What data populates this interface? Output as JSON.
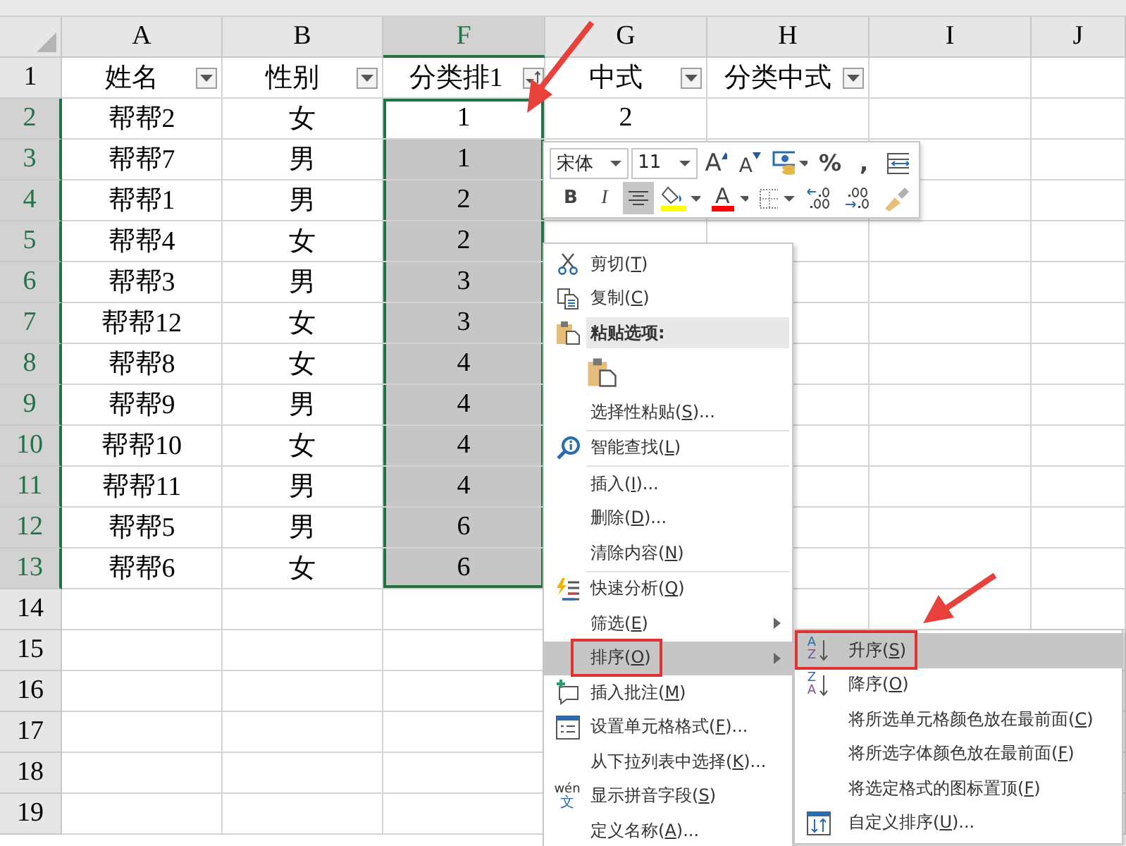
{
  "columns": [
    {
      "label": "A",
      "selected": false
    },
    {
      "label": "B",
      "selected": false
    },
    {
      "label": "F",
      "selected": true
    },
    {
      "label": "G",
      "selected": false
    },
    {
      "label": "H",
      "selected": false
    },
    {
      "label": "I",
      "selected": false
    },
    {
      "label": "J",
      "selected": false
    }
  ],
  "rows": [
    {
      "number": "1",
      "selected": false,
      "active": false,
      "cells": [
        {
          "text": "姓名",
          "kind": "dropdown"
        },
        {
          "text": "性别",
          "kind": "dropdown"
        },
        {
          "text": "分类排1",
          "kind": "sort"
        },
        {
          "text": "中式",
          "kind": "dropdown"
        },
        {
          "text": "分类中式",
          "kind": "dropdown"
        }
      ]
    },
    {
      "number": "2",
      "selected": true,
      "active": true,
      "cells": [
        {
          "text": "帮帮2"
        },
        {
          "text": "女"
        },
        {
          "text": "1"
        },
        {
          "text": "2"
        }
      ]
    },
    {
      "number": "3",
      "selected": true,
      "active": false,
      "cells": [
        {
          "text": "帮帮7"
        },
        {
          "text": "男"
        },
        {
          "text": "1"
        }
      ]
    },
    {
      "number": "4",
      "selected": true,
      "active": false,
      "cells": [
        {
          "text": "帮帮1"
        },
        {
          "text": "男"
        },
        {
          "text": "2"
        }
      ]
    },
    {
      "number": "5",
      "selected": true,
      "active": false,
      "cells": [
        {
          "text": "帮帮4"
        },
        {
          "text": "女"
        },
        {
          "text": "2"
        }
      ]
    },
    {
      "number": "6",
      "selected": true,
      "active": false,
      "cells": [
        {
          "text": "帮帮3"
        },
        {
          "text": "男"
        },
        {
          "text": "3"
        }
      ]
    },
    {
      "number": "7",
      "selected": true,
      "active": false,
      "cells": [
        {
          "text": "帮帮12"
        },
        {
          "text": "女"
        },
        {
          "text": "3"
        }
      ]
    },
    {
      "number": "8",
      "selected": true,
      "active": false,
      "cells": [
        {
          "text": "帮帮8"
        },
        {
          "text": "女"
        },
        {
          "text": "4"
        }
      ]
    },
    {
      "number": "9",
      "selected": true,
      "active": false,
      "cells": [
        {
          "text": "帮帮9"
        },
        {
          "text": "男"
        },
        {
          "text": "4"
        }
      ]
    },
    {
      "number": "10",
      "selected": true,
      "active": false,
      "cells": [
        {
          "text": "帮帮10"
        },
        {
          "text": "女"
        },
        {
          "text": "4"
        }
      ]
    },
    {
      "number": "11",
      "selected": true,
      "active": false,
      "cells": [
        {
          "text": "帮帮11"
        },
        {
          "text": "男"
        },
        {
          "text": "4"
        }
      ]
    },
    {
      "number": "12",
      "selected": true,
      "active": false,
      "cells": [
        {
          "text": "帮帮5"
        },
        {
          "text": "男"
        },
        {
          "text": "6"
        }
      ]
    },
    {
      "number": "13",
      "selected": true,
      "active": false,
      "cells": [
        {
          "text": "帮帮6"
        },
        {
          "text": "女"
        },
        {
          "text": "6"
        }
      ]
    },
    {
      "number": "14",
      "selected": false,
      "active": false
    },
    {
      "number": "15",
      "selected": false,
      "active": false
    },
    {
      "number": "16",
      "selected": false,
      "active": false
    },
    {
      "number": "17",
      "selected": false,
      "active": false
    },
    {
      "number": "18",
      "selected": false,
      "active": false
    },
    {
      "number": "19",
      "selected": false,
      "active": false
    }
  ],
  "mini_toolbar": {
    "font": "宋体",
    "size": "11",
    "row_1": [
      {
        "kind": "grow-font",
        "label": "A",
        "selected": false
      },
      {
        "kind": "shrink-font",
        "label": "A",
        "selected": false
      },
      {
        "kind": "number-format",
        "selected": false
      },
      {
        "kind": "percent",
        "label": "%",
        "selected": false
      },
      {
        "kind": "comma",
        "label": ",",
        "selected": false
      },
      {
        "kind": "merge",
        "selected": false
      }
    ],
    "row_2": [
      {
        "kind": "bold",
        "label": "B",
        "selected": false
      },
      {
        "kind": "italic",
        "label": "I",
        "selected": false
      },
      {
        "kind": "center",
        "selected": true
      },
      {
        "kind": "fill-color",
        "color": "#ffff00",
        "selected": false
      },
      {
        "kind": "font-color",
        "label": "A",
        "color": "#ff0000",
        "selected": false
      },
      {
        "kind": "borders",
        "selected": false
      },
      {
        "kind": "increase-decimal",
        "selected": false
      },
      {
        "kind": "decrease-decimal",
        "selected": false
      },
      {
        "kind": "format-painter",
        "selected": false
      }
    ]
  },
  "context_menu": {
    "items": [
      {
        "kind": "cut",
        "label": "剪切(",
        "key": "T",
        "after": ")",
        "selected": false,
        "outlined": false,
        "submenu": false
      },
      {
        "kind": "copy",
        "label": "复制(",
        "key": "C",
        "after": ")",
        "selected": false,
        "outlined": false,
        "submenu": false
      },
      {
        "kind": "header",
        "label": "粘贴选项:"
      },
      {
        "kind": "paste"
      },
      {
        "kind": "plain",
        "label": "选择性粘贴(",
        "key": "S",
        "after": ")...",
        "selected": false,
        "outlined": false,
        "submenu": false
      },
      {
        "kind": "separator"
      },
      {
        "kind": "lookup",
        "label": "智能查找(",
        "key": "L",
        "after": ")",
        "selected": false,
        "outlined": false,
        "submenu": false
      },
      {
        "kind": "separator"
      },
      {
        "kind": "plain",
        "label": "插入(",
        "key": "I",
        "after": ")...",
        "selected": false,
        "outlined": false,
        "submenu": false
      },
      {
        "kind": "plain",
        "label": "删除(",
        "key": "D",
        "after": ")...",
        "selected": false,
        "outlined": false,
        "submenu": false
      },
      {
        "kind": "plain",
        "label": "清除内容(",
        "key": "N",
        "after": ")",
        "selected": false,
        "outlined": false,
        "submenu": false
      },
      {
        "kind": "separator"
      },
      {
        "kind": "analysis",
        "label": "快速分析(",
        "key": "Q",
        "after": ")",
        "selected": false,
        "outlined": false,
        "submenu": false
      },
      {
        "kind": "plain",
        "label": "筛选(",
        "key": "E",
        "after": ")",
        "selected": false,
        "outlined": false,
        "submenu": true
      },
      {
        "kind": "plain",
        "label": "排序(",
        "key": "O",
        "after": ")",
        "selected": true,
        "outlined": true,
        "submenu": true
      },
      {
        "kind": "comment",
        "label": "插入批注(",
        "key": "M",
        "after": ")",
        "selected": false,
        "outlined": false,
        "submenu": false
      },
      {
        "kind": "format",
        "label": "设置单元格格式(",
        "key": "F",
        "after": ")...",
        "selected": false,
        "outlined": false,
        "submenu": false
      },
      {
        "kind": "plain",
        "label": "从下拉列表中选择(",
        "key": "K",
        "after": ")...",
        "selected": false,
        "outlined": false,
        "submenu": false
      },
      {
        "kind": "pinyin",
        "icon_label": [
          "wén",
          "文"
        ],
        "label": "显示拼音字段(",
        "key": "S",
        "after": ")",
        "selected": false,
        "outlined": false,
        "submenu": false
      },
      {
        "kind": "plain",
        "label": "定义名称(",
        "key": "A",
        "after": ")...",
        "selected": false,
        "outlined": false,
        "submenu": false
      }
    ]
  },
  "sort_submenu": {
    "items": [
      {
        "kind": "ascending",
        "icon_label": [
          "A",
          "Z"
        ],
        "label": "升序(",
        "key": "S",
        "after": ")",
        "selected": true,
        "outlined": true,
        "submenu": false
      },
      {
        "kind": "descending",
        "icon_label": [
          "Z",
          "A"
        ],
        "label": "降序(",
        "key": "O",
        "after": ")",
        "selected": false,
        "outlined": false,
        "submenu": false
      },
      {
        "kind": "plain",
        "label": "将所选单元格颜色放在最前面(",
        "key": "C",
        "after": ")",
        "selected": false,
        "outlined": false,
        "submenu": false
      },
      {
        "kind": "plain",
        "label": "将所选字体颜色放在最前面(",
        "key": "F",
        "after": ")",
        "selected": false,
        "outlined": false,
        "submenu": false
      },
      {
        "kind": "plain",
        "label": "将选定格式的图标置顶(",
        "key": "F",
        "after": ")",
        "selected": false,
        "outlined": false,
        "submenu": false
      },
      {
        "kind": "custom",
        "label": "自定义排序(",
        "key": "U",
        "after": ")...",
        "selected": false,
        "outlined": false,
        "submenu": false
      }
    ]
  }
}
